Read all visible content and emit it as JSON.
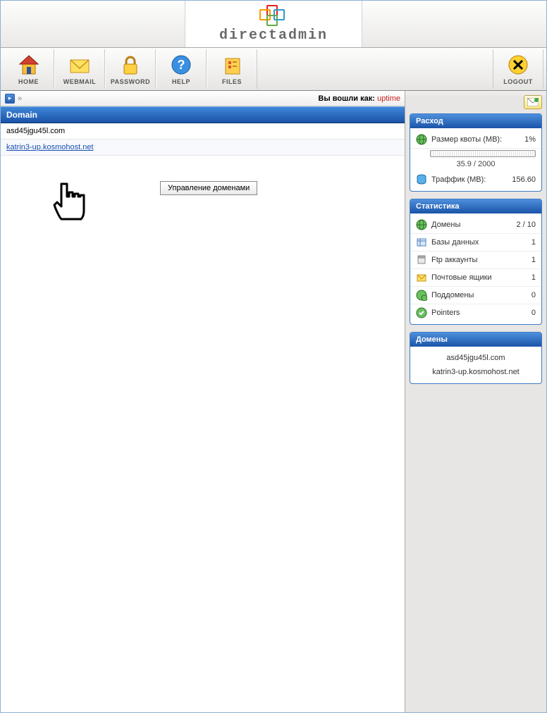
{
  "brand": "directadmin",
  "toolbar": {
    "home": "HOME",
    "webmail": "WEBMAIL",
    "password": "PASSWORD",
    "help": "HELP",
    "files": "FILES",
    "logout": "LOGOUT"
  },
  "breadcrumb": {
    "arrows": "»",
    "login_as_label": "Вы вошли как:",
    "user": "uptime"
  },
  "domain_section": {
    "header": "Domain",
    "rows": [
      "asd45jgu45l.com",
      "katrin3-up.kosmohost.net"
    ]
  },
  "manage_button": "Управление доменами",
  "panels": {
    "usage": {
      "title": "Расход",
      "quota_label": "Размер квоты (MB):",
      "quota_pct": "1%",
      "quota_text": "35.9 / 2000",
      "traffic_label": "Траффик (MB):",
      "traffic_val": "156.60"
    },
    "stats": {
      "title": "Статистика",
      "rows": [
        {
          "label": "Домены",
          "val": "2 / 10"
        },
        {
          "label": "Базы данных",
          "val": "1"
        },
        {
          "label": "Ftp аккаунты",
          "val": "1"
        },
        {
          "label": "Почтовые ящики",
          "val": "1"
        },
        {
          "label": "Поддомены",
          "val": "0"
        },
        {
          "label": "Pointers",
          "val": "0"
        }
      ]
    },
    "domains": {
      "title": "Домены",
      "list": [
        "asd45jgu45l.com",
        "katrin3-up.kosmohost.net"
      ]
    }
  }
}
